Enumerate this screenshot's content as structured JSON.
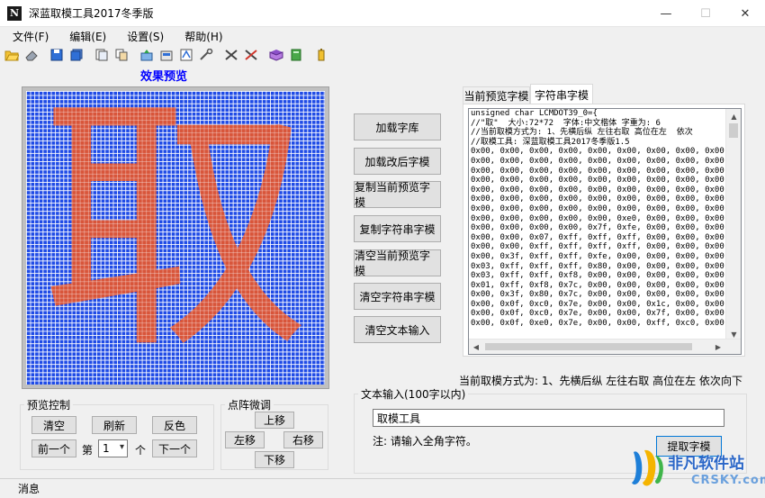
{
  "window": {
    "title": "深蓝取模工具2017冬季版",
    "minimize": "—",
    "maximize": "☐",
    "close": "✕"
  },
  "menu": [
    "文件(F)",
    "编辑(E)",
    "设置(S)",
    "帮助(H)"
  ],
  "toolbar_icons": [
    "open-folder-icon",
    "eraser-icon",
    "save-icon",
    "save-all-icon",
    "copy-icon",
    "copy-multi-icon",
    "export-icon",
    "import-icon",
    "font-add-icon",
    "tools-icon",
    "crossed-tools-icon",
    "tools-red-icon",
    "book-purple-icon",
    "book-green-icon",
    "battery-icon"
  ],
  "preview": {
    "title": "效果预览",
    "glyph": "取",
    "grid_color": "#1f4be6",
    "glyph_color": "#d8553a"
  },
  "preview_control": {
    "legend": "预览控制",
    "clear": "清空",
    "refresh": "刷新",
    "invert": "反色",
    "prev": "前一个",
    "page_label": "第",
    "page_value": "1",
    "unit": "个",
    "next": "下一个"
  },
  "nudge": {
    "legend": "点阵微调",
    "up": "上移",
    "left": "左移",
    "right": "右移",
    "down": "下移"
  },
  "actions": {
    "load_font": "加载字库",
    "load_modified": "加载改后字模",
    "copy_preview": "复制当前预览字模",
    "copy_string": "复制字符串字模",
    "clear_preview": "清空当前预览字模",
    "clear_string": "清空字符串字模",
    "clear_text": "清空文本输入"
  },
  "tabs": [
    "当前预览字模",
    "字符串字模"
  ],
  "code_lines": [
    "unsigned char LCMDOT39_0={",
    "//\"取\"  大小:72*72  字体:中文楷体 字重为: 6",
    "//当前取模方式为: 1、先横后纵 左往右取 高位在左  依次",
    "//取模工具: 深蓝取模工具2017冬季版1.5",
    "0x00, 0x00, 0x00, 0x00, 0x00, 0x00, 0x00, 0x00, 0x00",
    "0x00, 0x00, 0x00, 0x00, 0x00, 0x00, 0x00, 0x00, 0x00",
    "0x00, 0x00, 0x00, 0x00, 0x00, 0x00, 0x00, 0x00, 0x00",
    "0x00, 0x00, 0x00, 0x00, 0x00, 0x00, 0x00, 0x00, 0x00",
    "0x00, 0x00, 0x00, 0x00, 0x00, 0x00, 0x00, 0x00, 0x00",
    "0x00, 0x00, 0x00, 0x00, 0x00, 0x00, 0x00, 0x00, 0x00",
    "0x00, 0x00, 0x00, 0x00, 0x00, 0x00, 0x00, 0x00, 0x00",
    "0x00, 0x00, 0x00, 0x00, 0x00, 0xe0, 0x00, 0x00, 0x00",
    "0x00, 0x00, 0x00, 0x00, 0x7f, 0xfe, 0x00, 0x00, 0x00",
    "0x00, 0x00, 0x07, 0xff, 0xff, 0xff, 0x00, 0x00, 0x00",
    "0x00, 0x00, 0xff, 0xff, 0xff, 0xff, 0x00, 0x00, 0x00",
    "0x00, 0x3f, 0xff, 0xff, 0xfe, 0x00, 0x00, 0x00, 0x00",
    "0x03, 0xff, 0xff, 0xff, 0x80, 0x00, 0x00, 0x00, 0x00",
    "0x03, 0xff, 0xff, 0xf8, 0x00, 0x00, 0x00, 0x00, 0x00",
    "0x01, 0xff, 0xf8, 0x7c, 0x00, 0x00, 0x00, 0x00, 0x00",
    "0x00, 0x3f, 0x80, 0x7c, 0x00, 0x00, 0x00, 0x00, 0x00",
    "0x00, 0x0f, 0xc0, 0x7e, 0x00, 0x00, 0x1c, 0x00, 0x00",
    "0x00, 0x0f, 0xc0, 0x7e, 0x00, 0x00, 0x7f, 0x00, 0x00",
    "0x00, 0x0f, 0xe0, 0x7e, 0x00, 0x00, 0xff, 0xc0, 0x00"
  ],
  "mode_text": "当前取模方式为: 1、先横后纵 左往右取 高位在左 依次向下",
  "text_input": {
    "legend": "文本输入(100字以内)",
    "value": "取模工具",
    "note": "注: 请输入全角字符。",
    "extract": "提取字模"
  },
  "status": "消息",
  "watermark": {
    "text": "非凡软件站",
    "sub": "CRSKY.com"
  }
}
